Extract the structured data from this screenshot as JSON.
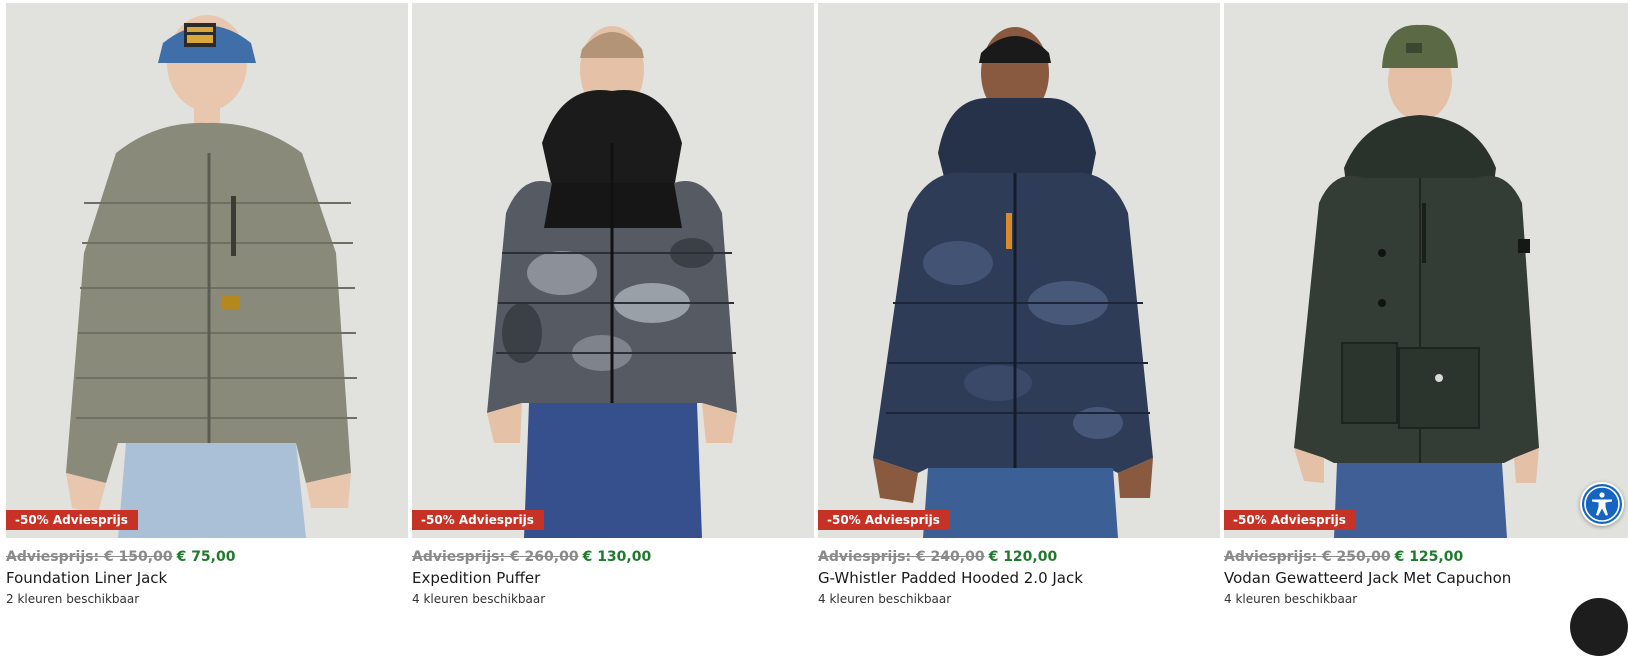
{
  "accent_colors": {
    "discount_badge": "#c63225",
    "sale_price": "#1f7a2c",
    "old_price": "#8a8a8a",
    "accessibility": "#1565c0"
  },
  "products": [
    {
      "badge": "-50% Adviesprijs",
      "old_price": "Adviesprijs: € 150,00",
      "new_price": "€ 75,00",
      "name": "Foundation Liner Jack",
      "colors": "2 kleuren beschikbaar",
      "image_icon": "model-photo"
    },
    {
      "badge": "-50% Adviesprijs",
      "old_price": "Adviesprijs: € 260,00",
      "new_price": "€ 130,00",
      "name": "Expedition Puffer",
      "colors": "4 kleuren beschikbaar",
      "image_icon": "model-photo"
    },
    {
      "badge": "-50% Adviesprijs",
      "old_price": "Adviesprijs: € 240,00",
      "new_price": "€ 120,00",
      "name": "G-Whistler Padded Hooded 2.0 Jack",
      "colors": "4 kleuren beschikbaar",
      "image_icon": "model-photo"
    },
    {
      "badge": "-50% Adviesprijs",
      "old_price": "Adviesprijs: € 250,00",
      "new_price": "€ 125,00",
      "name": "Vodan Gewatteerd Jack Met Capuchon",
      "colors": "4 kleuren beschikbaar",
      "image_icon": "model-photo"
    }
  ],
  "widgets": {
    "accessibility_icon": "accessibility-icon"
  }
}
